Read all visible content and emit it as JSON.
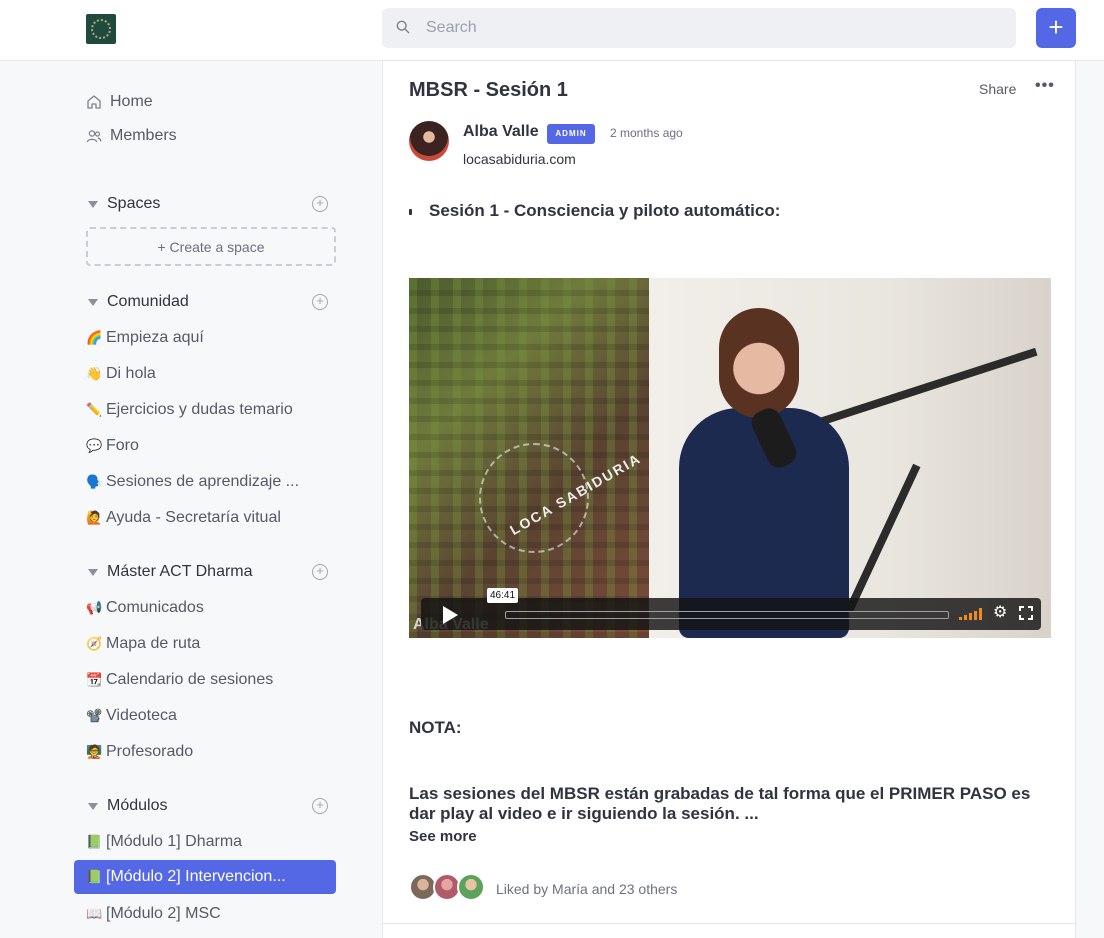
{
  "header": {
    "search_placeholder": "Search",
    "create_button_label": "+"
  },
  "sidebar": {
    "links": [
      {
        "label": "Home",
        "icon": "home-icon"
      },
      {
        "label": "Members",
        "icon": "members-icon"
      }
    ],
    "spaces": {
      "title": "Spaces",
      "create_label": "+ Create a space"
    },
    "groups": [
      {
        "title": "Comunidad",
        "items": [
          {
            "emoji": "🌈",
            "label": "Empieza aquí"
          },
          {
            "emoji": "👋",
            "label": "Di hola"
          },
          {
            "emoji": "✏️",
            "label": "Ejercicios y dudas temario"
          },
          {
            "emoji": "💬",
            "label": "Foro"
          },
          {
            "emoji": "🗣️",
            "label": "Sesiones de aprendizaje ..."
          },
          {
            "emoji": "🙋",
            "label": "Ayuda - Secretaría vitual"
          }
        ]
      },
      {
        "title": "Máster ACT Dharma",
        "items": [
          {
            "emoji": "📢",
            "label": "Comunicados"
          },
          {
            "emoji": "🧭",
            "label": "Mapa de ruta"
          },
          {
            "emoji": "📆",
            "label": "Calendario de sesiones"
          },
          {
            "emoji": "📽️",
            "label": "Videoteca"
          },
          {
            "emoji": "🧑‍🏫",
            "label": "Profesorado"
          }
        ]
      },
      {
        "title": "Módulos",
        "items": [
          {
            "emoji": "📗",
            "label": "[Módulo 1] Dharma"
          },
          {
            "emoji": "📗",
            "label": "[Módulo 2] Intervencion..."
          },
          {
            "emoji": "📖",
            "label": "[Módulo 2] MSC"
          }
        ]
      }
    ]
  },
  "post": {
    "title": "MBSR - Sesión 1",
    "share_label": "Share",
    "more_label": "•••",
    "author": "Alba Valle",
    "badge": "ADMIN",
    "time": "2 months ago",
    "author_subtitle": "locasabiduria.com",
    "session_heading": "Sesión 1 - Consciencia y piloto automático:",
    "video": {
      "duration": "46:41",
      "watermark": "Alba Valle",
      "brand_text": "LOCA SABIDURIA"
    },
    "nota": "NOTA:",
    "body": "Las sesiones del MBSR están grabadas de tal forma que el PRIMER PASO es dar play al video e ir siguiendo la sesión. ...",
    "see_more": "See more",
    "likes_text": "Liked by María and 23 others"
  },
  "colors": {
    "accent": "#5468e5",
    "volume": "#f08a24"
  }
}
